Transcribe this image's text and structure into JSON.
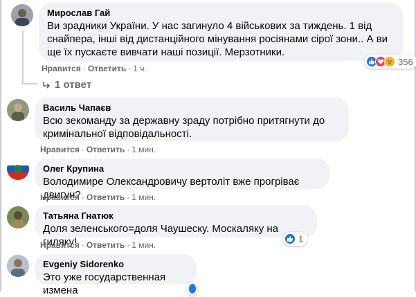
{
  "action_labels": {
    "like": "Нравится",
    "reply": "Ответить",
    "separator": "·"
  },
  "comments": [
    {
      "author": "Мирослав Гай",
      "text": "Ви зрадники України. У нас загинуло 4 військових за тиждень. 1 від снайпера, інші від дистанційного мінування росіянами сірої зони.. А ви ще їх пускаєте вивчати наші позиції. Мерзотники.",
      "time": "1 ч.",
      "reactions": {
        "icons": [
          "like-icon",
          "love-icon",
          "sad-icon"
        ],
        "count": "356"
      },
      "replies_label": "1 ответ"
    },
    {
      "author": "Василь Чапаєв",
      "text": "Всю зекоманду за державну зраду потрібно притягнути до кримінальної відповідальності.",
      "time": "1 мин."
    },
    {
      "author": "Олег Крупина",
      "text": "Володимире Олександровичу вертоліт вже прогріває двигун?",
      "time": "1 мин."
    },
    {
      "author": "Татьяна Гнатюк",
      "text": "Доля зеленського=доля Чаушеску. Москаляку на гиляку!",
      "time": "1 мин.",
      "reactions": {
        "icons": [
          "like-icon"
        ],
        "count": "1"
      }
    },
    {
      "author": "Evgeniy Sidorenko",
      "text": "Это уже государственная измена",
      "reactions": {
        "icons": [],
        "count": ""
      }
    }
  ],
  "colors": {
    "bubble": "#f0f2f5",
    "meta_text": "#65676b",
    "like_blue": "#1877f2",
    "love_red": "#f33e58",
    "sad_yellow": "#f7b125"
  }
}
